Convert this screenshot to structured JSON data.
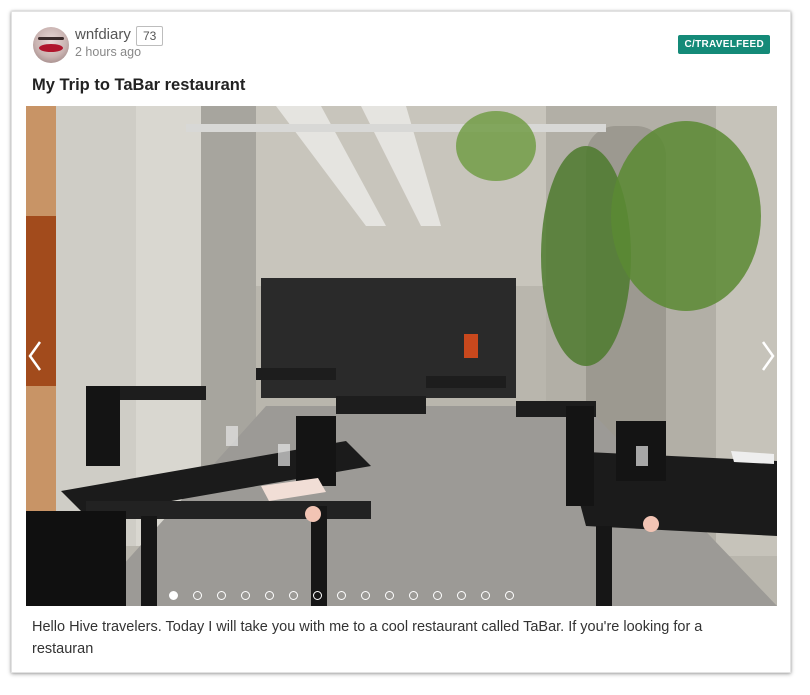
{
  "post": {
    "author": "wnfdiary",
    "reputation": "73",
    "time": "2 hours ago",
    "community": "C/TRAVELFEED",
    "title": "My Trip to TaBar restaurant",
    "excerpt": "Hello Hive travelers. Today I will take you with me to a cool restaurant called TaBar. If you're looking for a restauran"
  },
  "carousel": {
    "image_subject": "restaurant-interior-photo",
    "slide_count": 15,
    "active_slide": 1
  },
  "colors": {
    "community_badge": "#148a78",
    "text": "#333333",
    "muted": "#888888"
  }
}
